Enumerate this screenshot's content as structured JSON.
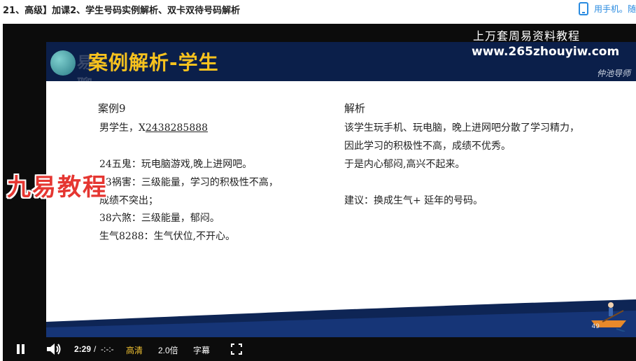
{
  "page": {
    "title": "21、高级】加课2、学生号码实例解析、双卡双待号码解析",
    "phone_link": "用手机。随"
  },
  "slide": {
    "title": "案例解析-学生",
    "logo_watermark": "易聊",
    "signature": "仲池导师",
    "left": {
      "heading": "案例9",
      "subject_prefix": "男学生，X",
      "number": "2438285888",
      "line1": "24五鬼：玩电脑游戏,晚上进网吧。",
      "line2": "43祸害：三级能量，学习的积极性不高，",
      "line3": "成绩不突出；",
      "line4": "38六煞：三级能量，郁闷。",
      "line5": "生气8288：生气伏位,不开心。"
    },
    "right": {
      "heading": "解析",
      "line1": "该学生玩手机、玩电脑，晚上进网吧分散了学习精力，",
      "line2": "因此学习的积极性不高，成绩不优秀。",
      "line3": "于是内心郁闷,高兴不起来。",
      "advice": "建议：换成生气+ 延年的号码。"
    },
    "page_number": "49"
  },
  "overlays": {
    "site_cn": "上万套周易资料教程",
    "site_url": "www.265zhouyiw.com",
    "brand": "九易教程"
  },
  "controls": {
    "time_current": "2:29",
    "time_separator": "/",
    "time_duration": "-:-:-",
    "quality": "高清",
    "speed": "2.0倍",
    "subtitle": "字幕"
  },
  "colors": {
    "banner": "#0b1f4a",
    "title_yellow": "#f7c21e",
    "brand_red": "#e53631",
    "link_blue": "#2a8be0",
    "quality_gold": "#f1c232"
  }
}
